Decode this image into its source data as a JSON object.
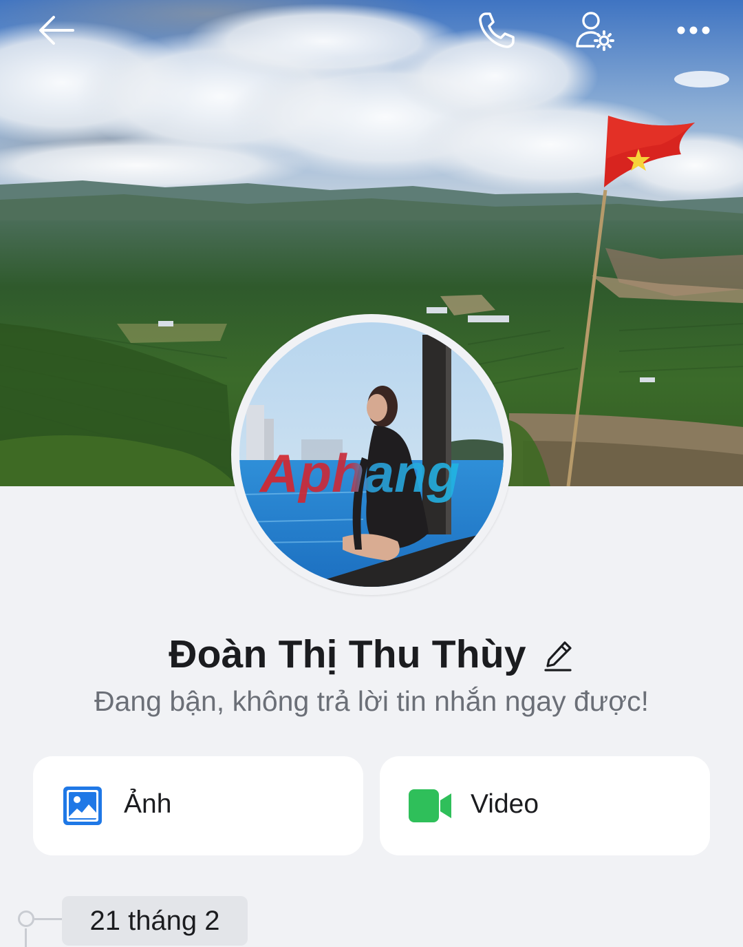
{
  "header": {
    "back_icon": "arrow-left-icon",
    "call_icon": "phone-icon",
    "settings_icon": "user-settings-icon",
    "more_icon": "more-horizontal-icon"
  },
  "profile": {
    "name": "Đoàn Thị Thu Thùy",
    "status": "Đang bận, không trả lời tin nhắn ngay được!",
    "avatar_watermark": "Aphang"
  },
  "media": {
    "photos_label": "Ảnh",
    "videos_label": "Video",
    "photos_icon": "image-icon",
    "videos_icon": "video-camera-icon"
  },
  "timeline": {
    "date": "21 tháng 2"
  },
  "colors": {
    "background": "#f1f2f5",
    "photos_icon": "#1f78e6",
    "videos_icon": "#2fbf5a",
    "text_primary": "#1b1c1f",
    "text_secondary": "#6b6f77"
  }
}
